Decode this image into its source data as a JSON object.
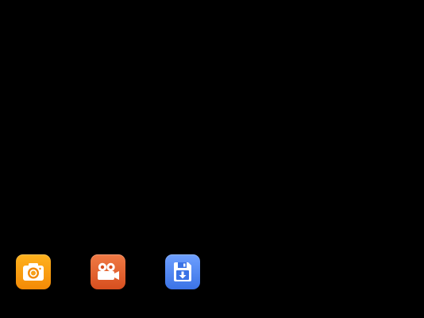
{
  "toolbar": {
    "buttons": [
      {
        "name": "camera-button",
        "icon": "camera-icon",
        "color": "#F7960E"
      },
      {
        "name": "video-button",
        "icon": "video-camera-icon",
        "color": "#E0612E"
      },
      {
        "name": "save-button",
        "icon": "save-download-icon",
        "color": "#4D84F5"
      }
    ]
  }
}
